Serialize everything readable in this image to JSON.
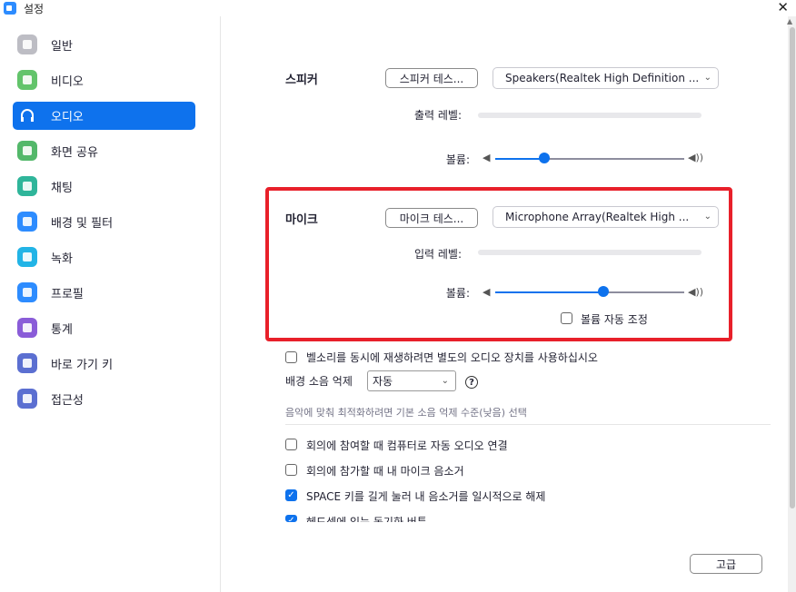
{
  "window": {
    "title": "설정",
    "close": "✕"
  },
  "sidebar": {
    "items": [
      {
        "label": "일반",
        "icon": "gear-icon",
        "color": "#bdbdc4"
      },
      {
        "label": "비디오",
        "icon": "video-icon",
        "color": "#63c46b"
      },
      {
        "label": "오디오",
        "icon": "headphones-icon",
        "color": "#ffffff"
      },
      {
        "label": "화면 공유",
        "icon": "share-screen-icon",
        "color": "#53b86a"
      },
      {
        "label": "채팅",
        "icon": "chat-icon",
        "color": "#2fb59a"
      },
      {
        "label": "배경 및 필터",
        "icon": "background-icon",
        "color": "#2d8cff"
      },
      {
        "label": "녹화",
        "icon": "record-icon",
        "color": "#22b4e6"
      },
      {
        "label": "프로필",
        "icon": "profile-icon",
        "color": "#2d8cff"
      },
      {
        "label": "통계",
        "icon": "statistics-icon",
        "color": "#8a5cd8"
      },
      {
        "label": "바로 가기 키",
        "icon": "keyboard-icon",
        "color": "#5b6fd1"
      },
      {
        "label": "접근성",
        "icon": "accessibility-icon",
        "color": "#5b6fd1"
      }
    ],
    "active_index": 2
  },
  "speaker": {
    "label": "스피커",
    "test_button": "스피커 테스...",
    "device": "Speakers(Realtek High Definition ...",
    "output_level_label": "출력 레벨:",
    "volume_label": "볼륨:",
    "volume": 0.26
  },
  "mic": {
    "label": "마이크",
    "test_button": "마이크 테스...",
    "device": "Microphone Array(Realtek High ...",
    "input_level_label": "입력 레벨:",
    "volume_label": "볼륨:",
    "volume": 0.57,
    "auto_adjust": {
      "label": "볼륨 자동 조정",
      "checked": false
    }
  },
  "ringtone": {
    "label": "벨소리를 동시에 재생하려면 별도의 오디오 장치를 사용하십시오",
    "checked": false
  },
  "noise": {
    "label": "배경 소음 억제",
    "value": "자동",
    "help": "?",
    "hint": "음악에 맞춰 최적화하려면 기본 소음 억제 수준(낮음) 선택"
  },
  "options": [
    {
      "label": "회의에 참여할 때 컴퓨터로 자동 오디오 연결",
      "checked": false
    },
    {
      "label": "회의에 참가할 때 내 마이크 음소거",
      "checked": false
    },
    {
      "label": "SPACE 키를 길게 눌러 내 음소거를 일시적으로 해제",
      "checked": true
    },
    {
      "label": "헤드셋에 있는 동기화 버튼",
      "checked": true
    }
  ],
  "advanced_button": "고급"
}
